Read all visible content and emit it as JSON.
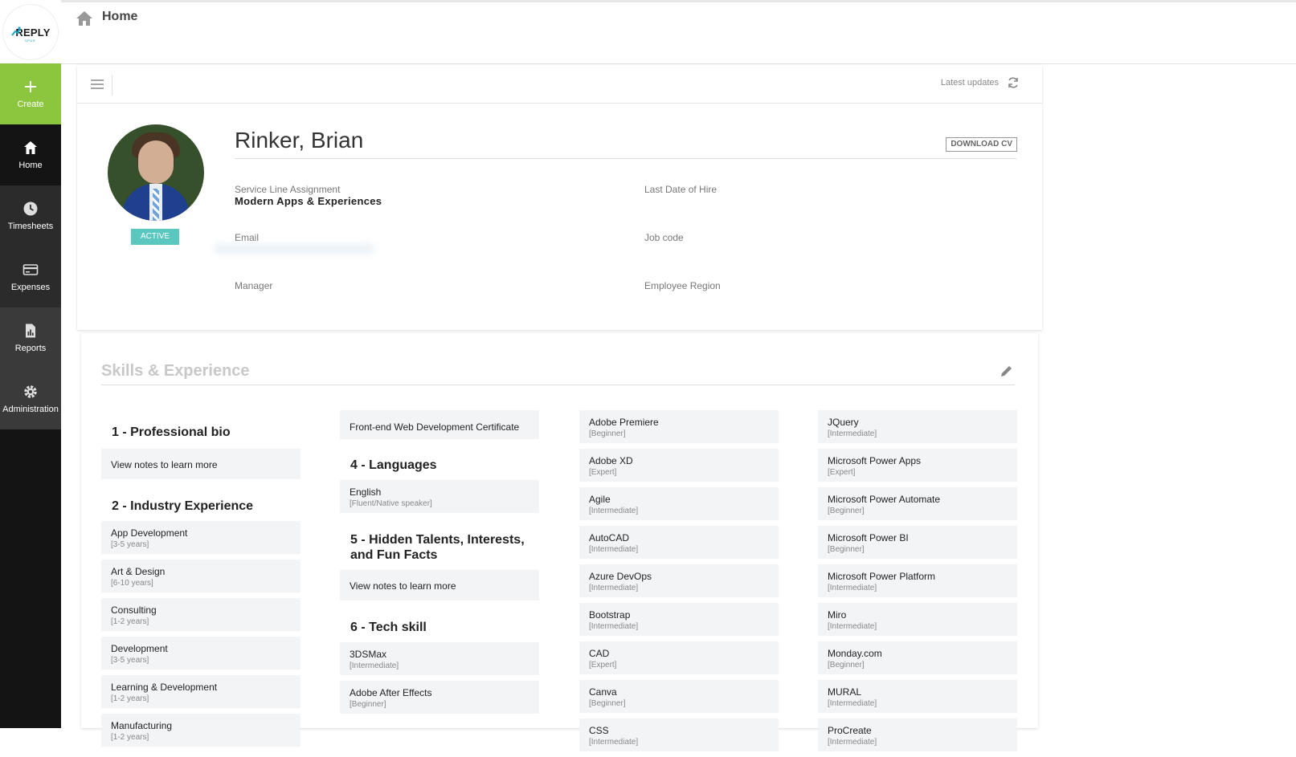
{
  "brand": {
    "logo_text": "REPLY",
    "logo_sub": "SPUR"
  },
  "nav": {
    "create": "Create",
    "home": "Home",
    "timesheets": "Timesheets",
    "expenses": "Expenses",
    "reports": "Reports",
    "administration": "Administration"
  },
  "header": {
    "title": "Home"
  },
  "toolbar": {
    "latest_updates": "Latest updates"
  },
  "profile": {
    "name": "Rinker, Brian",
    "status": "ACTIVE",
    "download_cv": "DOWNLOAD CV",
    "fields": {
      "service_line_label": "Service Line Assignment",
      "service_line_value": "Modern Apps & Experiences",
      "last_hire_label": "Last Date of Hire",
      "email_label": "Email",
      "job_code_label": "Job code",
      "manager_label": "Manager",
      "region_label": "Employee Region"
    }
  },
  "skills": {
    "title": "Skills & Experience",
    "col1": {
      "bio_title": "1 - Professional bio",
      "bio_note": "View notes to learn more",
      "industry_title": "2 - Industry Experience",
      "industry": [
        {
          "name": "App Development",
          "level": "[3-5 years]"
        },
        {
          "name": "Art & Design",
          "level": "[6-10 years]"
        },
        {
          "name": "Consulting",
          "level": "[1-2 years]"
        },
        {
          "name": "Development",
          "level": "[3-5 years]"
        },
        {
          "name": "Learning & Development",
          "level": "[1-2 years]"
        },
        {
          "name": "Manufacturing",
          "level": "[1-2 years]"
        }
      ]
    },
    "col2": {
      "certificate": "Front-end Web Development Certificate",
      "languages_title": "4 - Languages",
      "language": {
        "name": "English",
        "level": "[Fluent/Native speaker]"
      },
      "talents_title": "5 - Hidden Talents, Interests, and Fun Facts",
      "talents_note": "View notes to learn more",
      "tech_title": "6 - Tech skill",
      "tech": [
        {
          "name": "3DSMax",
          "level": "[Intermediate]"
        },
        {
          "name": "Adobe After Effects",
          "level": "[Beginner]"
        }
      ]
    },
    "col3": [
      {
        "name": "Adobe Premiere",
        "level": "[Beginner]"
      },
      {
        "name": "Adobe XD",
        "level": "[Expert]"
      },
      {
        "name": "Agile",
        "level": "[Intermediate]"
      },
      {
        "name": "AutoCAD",
        "level": "[Intermediate]"
      },
      {
        "name": "Azure DevOps",
        "level": "[Intermediate]"
      },
      {
        "name": "Bootstrap",
        "level": "[Intermediate]"
      },
      {
        "name": "CAD",
        "level": "[Expert]"
      },
      {
        "name": "Canva",
        "level": "[Beginner]"
      },
      {
        "name": "CSS",
        "level": "[Intermediate]"
      }
    ],
    "col4": [
      {
        "name": "JQuery",
        "level": "[Intermediate]"
      },
      {
        "name": "Microsoft Power Apps",
        "level": "[Expert]"
      },
      {
        "name": "Microsoft Power Automate",
        "level": "[Beginner]"
      },
      {
        "name": "Microsoft Power BI",
        "level": "[Beginner]"
      },
      {
        "name": "Microsoft Power Platform",
        "level": "[Intermediate]"
      },
      {
        "name": "Miro",
        "level": "[Intermediate]"
      },
      {
        "name": "Monday.com",
        "level": "[Beginner]"
      },
      {
        "name": "MURAL",
        "level": "[Intermediate]"
      },
      {
        "name": "ProCreate",
        "level": "[Intermediate]"
      }
    ]
  },
  "colors": {
    "accent_green": "#8cc63f",
    "status_teal": "#5bc8c0",
    "sidebar_bg": "#141414"
  }
}
